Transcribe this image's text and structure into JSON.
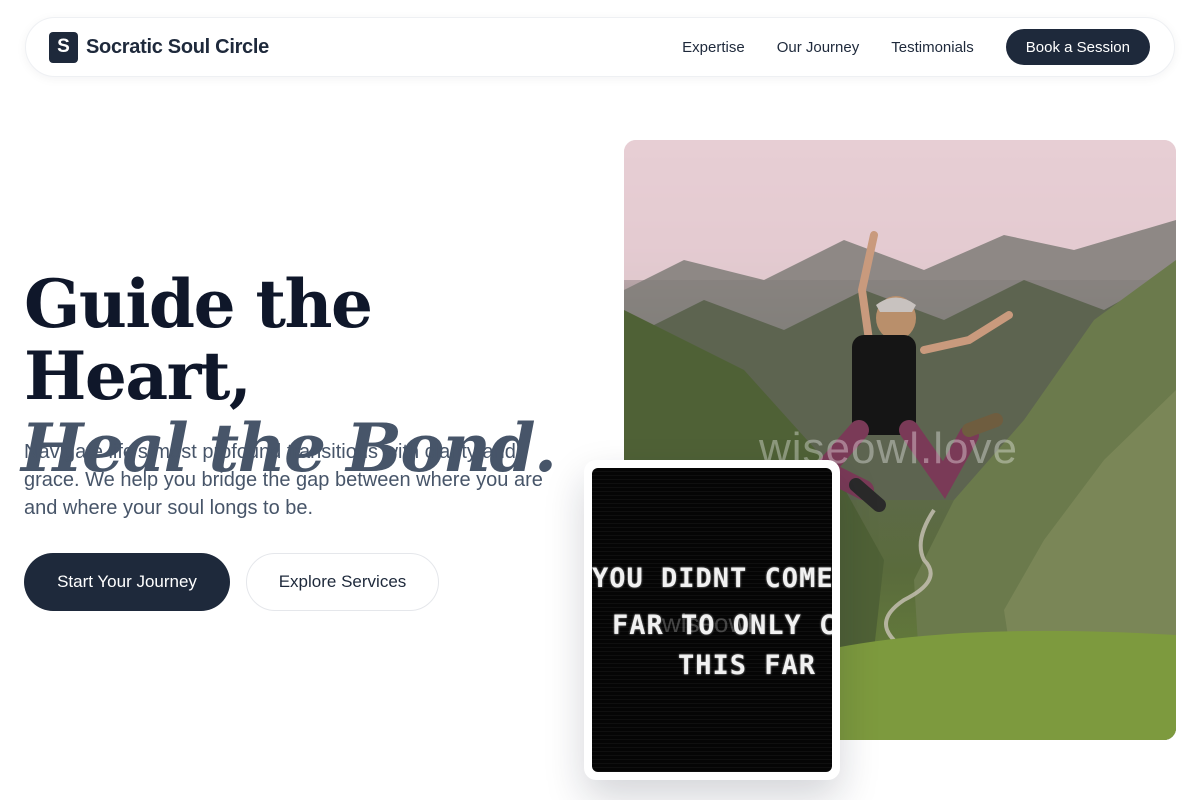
{
  "brand": {
    "logo_letter": "S",
    "name": "Socratic Soul Circle"
  },
  "nav": {
    "links": [
      "Expertise",
      "Our Journey",
      "Testimonials"
    ],
    "cta": "Book a Session"
  },
  "hero": {
    "headline_line1": "Guide the Heart,",
    "headline_line2": "Heal the Bond.",
    "subtitle": "Navigate life's most profound transitions with clarity and grace. We help you bridge the gap between where you are and where your soul longs to be.",
    "primary_button": "Start Your Journey",
    "secondary_button": "Explore Services"
  },
  "images": {
    "main_watermark": "wiseowl.love",
    "card_watermark": "wiseowl",
    "card_quote_lines": [
      "YOU DIDNT COME THIS",
      "FAR TO ONLY COME",
      "THIS FAR"
    ]
  },
  "colors": {
    "primary": "#1e293b",
    "heading": "#0f172a",
    "muted": "#475569",
    "background": "#ffffff"
  }
}
